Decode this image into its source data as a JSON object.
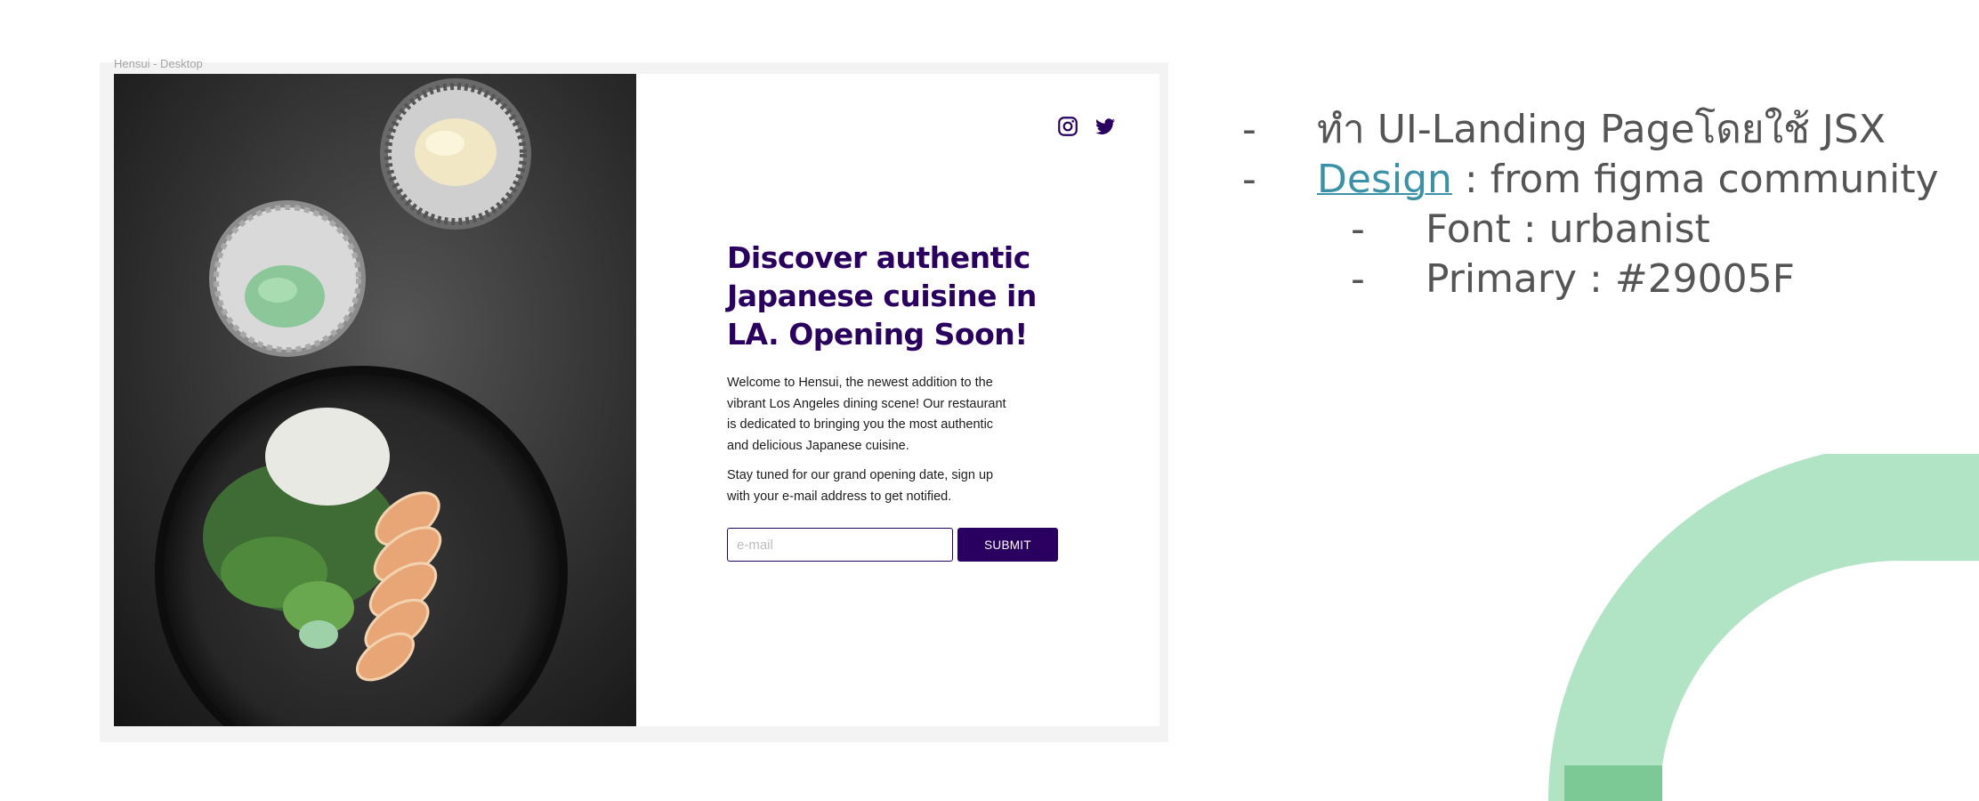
{
  "slide": {
    "title": ""
  },
  "frame": {
    "label": "Hensui - Desktop"
  },
  "hero": {
    "headline": "Discover authentic Japanese cuisine in LA. Opening Soon!",
    "intro": "Welcome to Hensui, the newest addition to the vibrant Los Angeles dining scene! Our restaurant is dedicated to bringing you the most authentic and delicious Japanese cuisine.",
    "notify": "Stay tuned for our grand opening date, sign up with your e-mail address to get notified.",
    "email_placeholder": "e-mail",
    "submit_label": "SUBMIT",
    "icons": [
      "instagram-icon",
      "twitter-icon"
    ]
  },
  "notes": {
    "dash": "-",
    "item1": "ทำ UI-Landing Pageโดยใช้ JSX",
    "item2_link": "Design",
    "item2_rest": " : from figma community",
    "item3": "Font : urbanist",
    "item4": "Primary :  #29005F"
  },
  "colors": {
    "primary": "#29005F",
    "title_blue": "#3358c4",
    "link": "#3a92a6",
    "decor_green": "#a8e0bf"
  }
}
